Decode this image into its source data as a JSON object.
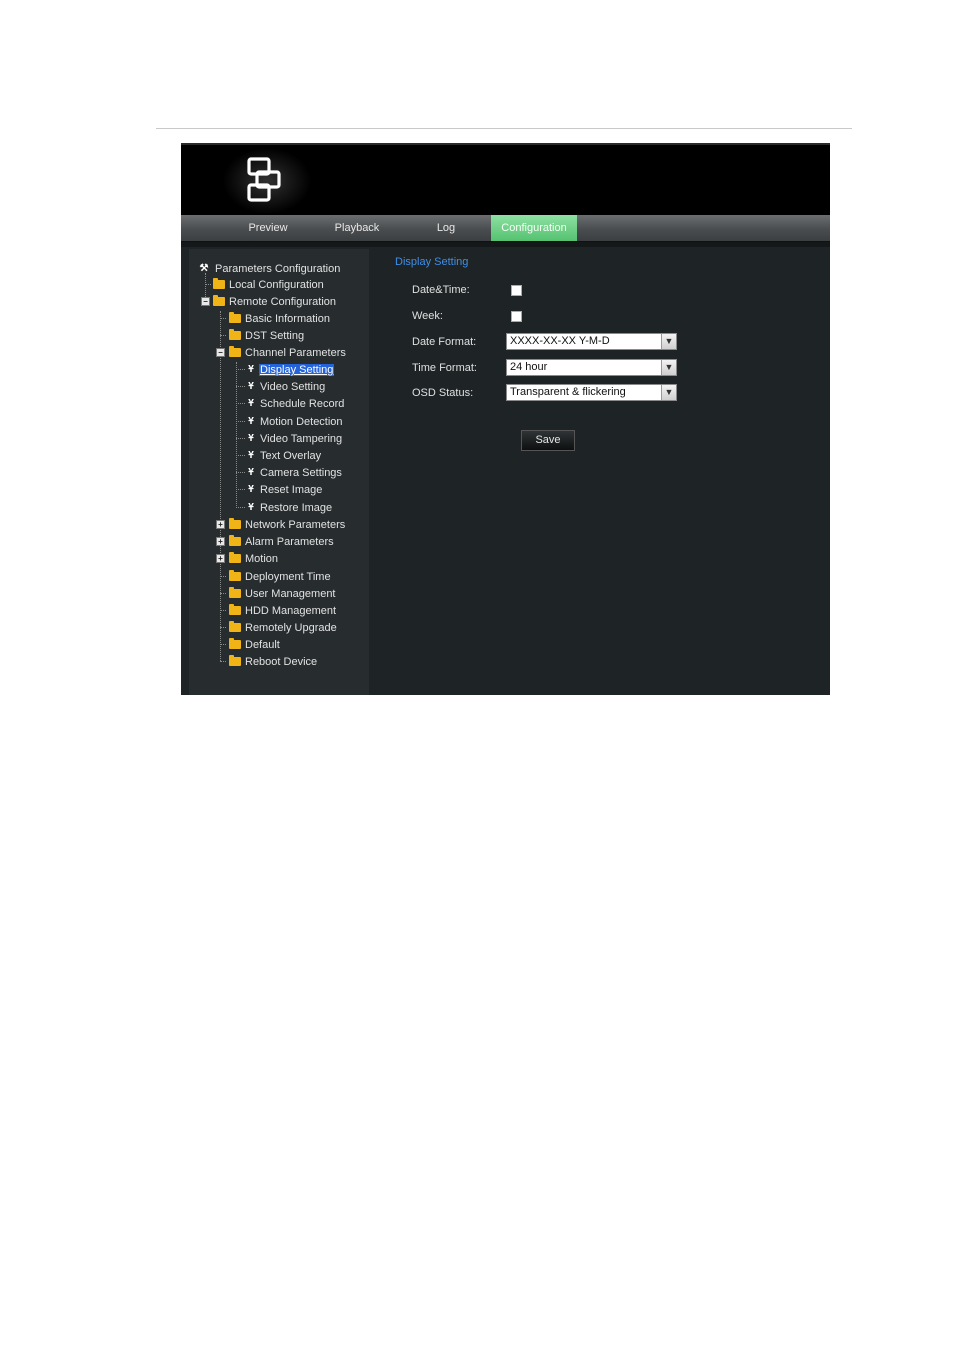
{
  "menu": {
    "items": [
      {
        "label": "Preview"
      },
      {
        "label": "Playback"
      },
      {
        "label": "Log"
      },
      {
        "label": "Configuration",
        "active": true
      }
    ]
  },
  "tree": {
    "root": "Parameters Configuration",
    "items": [
      {
        "label": "Local Configuration",
        "icon": "folder-icon"
      },
      {
        "label": "Remote Configuration",
        "icon": "folder-icon",
        "expanded": true
      },
      {
        "label": "Basic Information",
        "icon": "folder-icon"
      },
      {
        "label": "DST Setting",
        "icon": "folder-icon"
      },
      {
        "label": "Channel Parameters",
        "icon": "folder-icon",
        "expanded": true
      },
      {
        "label": "Display Setting",
        "icon": "setting-icon",
        "selected": true
      },
      {
        "label": "Video Setting",
        "icon": "setting-icon"
      },
      {
        "label": "Schedule Record",
        "icon": "setting-icon"
      },
      {
        "label": "Motion Detection",
        "icon": "setting-icon"
      },
      {
        "label": "Video Tampering",
        "icon": "setting-icon"
      },
      {
        "label": "Text Overlay",
        "icon": "setting-icon"
      },
      {
        "label": "Camera Settings",
        "icon": "setting-icon"
      },
      {
        "label": "Reset Image",
        "icon": "setting-icon"
      },
      {
        "label": "Restore Image",
        "icon": "setting-icon"
      },
      {
        "label": "Network Parameters",
        "icon": "folder-icon",
        "expanded": false
      },
      {
        "label": "Alarm Parameters",
        "icon": "folder-icon",
        "expanded": false
      },
      {
        "label": "Motion",
        "icon": "folder-icon",
        "expanded": false
      },
      {
        "label": "Deployment Time",
        "icon": "folder-icon"
      },
      {
        "label": "User Management",
        "icon": "folder-icon"
      },
      {
        "label": "HDD Management",
        "icon": "folder-icon"
      },
      {
        "label": "Remotely Upgrade",
        "icon": "folder-icon"
      },
      {
        "label": "Default",
        "icon": "folder-icon"
      },
      {
        "label": "Reboot Device",
        "icon": "folder-icon"
      }
    ]
  },
  "content": {
    "title": "Display Setting",
    "fields": {
      "datetime_label": "Date&Time:",
      "datetime_checked": false,
      "week_label": "Week:",
      "week_checked": false,
      "date_format_label": "Date Format:",
      "date_format_value": "XXXX-XX-XX Y-M-D",
      "time_format_label": "Time Format:",
      "time_format_value": "24 hour",
      "osd_status_label": "OSD Status:",
      "osd_status_value": "Transparent & flickering"
    },
    "save_label": "Save"
  },
  "colors": {
    "accent_active_tab": "#55c270",
    "section_title": "#3f8ee8",
    "selected_item": "#2563d8",
    "folder": "#f1b417"
  }
}
